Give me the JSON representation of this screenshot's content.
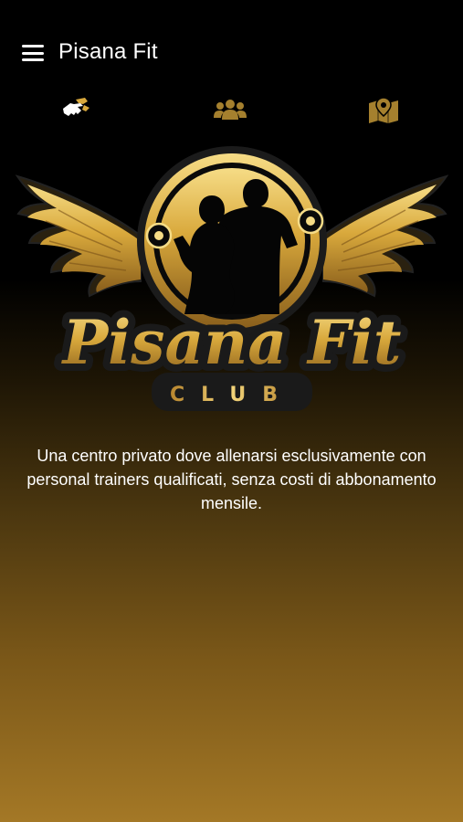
{
  "app_bar": {
    "title": "Pisana Fit",
    "menu_icon": "hamburger-menu-icon"
  },
  "tabs": [
    {
      "icon": "handshake-icon",
      "active": true
    },
    {
      "icon": "users-group-icon",
      "active": false
    },
    {
      "icon": "map-location-icon",
      "active": false
    }
  ],
  "logo": {
    "brand": "Pisana Fit",
    "tagline": "CLUB"
  },
  "content": {
    "description": "Una centro privato dove allenarsi esclusivamente con personal trainers qualificati, senza costi di abbonamento mensile."
  },
  "colors": {
    "gold": "#d9a93c",
    "gold_light": "#f6dc86",
    "tab_inactive": "#a5802e",
    "background_top": "#000000",
    "background_bottom": "#a47826"
  }
}
